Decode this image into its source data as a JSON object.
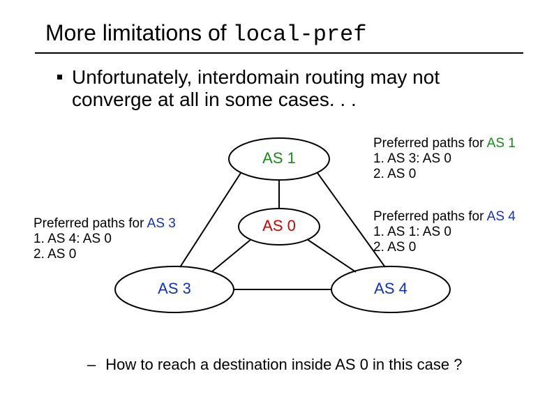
{
  "title": {
    "plain": "More limitations of ",
    "code": "local-pref"
  },
  "bullet": "Unfortunately, interdomain routing may not converge at all in some cases. . .",
  "nodes": {
    "as1": "AS 1",
    "as0": "AS 0",
    "as3": "AS 3",
    "as4": "AS 4"
  },
  "pp_as1": {
    "heading_pre": "Preferred paths for ",
    "heading_as": "AS 1",
    "l1": "1. AS 3: AS 0",
    "l2": "2. AS 0"
  },
  "pp_as4": {
    "heading_pre": "Preferred paths for ",
    "heading_as": "AS 4",
    "l1": "1. AS 1: AS 0",
    "l2": "2. AS 0"
  },
  "pp_as3": {
    "heading_pre": "Preferred paths for ",
    "heading_as": "AS 3",
    "l1": "1. AS 4: AS 0",
    "l2": "2. AS 0"
  },
  "sub_bullet": "How to reach a destination inside AS 0 in this case ?",
  "chart_data": {
    "type": "diagram",
    "title": "BGP local-pref oscillation (non-converging interdomain routing)",
    "nodes": [
      {
        "id": "AS0",
        "label": "AS 0"
      },
      {
        "id": "AS1",
        "label": "AS 1"
      },
      {
        "id": "AS3",
        "label": "AS 3"
      },
      {
        "id": "AS4",
        "label": "AS 4"
      }
    ],
    "edges": [
      [
        "AS1",
        "AS0"
      ],
      [
        "AS1",
        "AS3"
      ],
      [
        "AS1",
        "AS4"
      ],
      [
        "AS3",
        "AS0"
      ],
      [
        "AS4",
        "AS0"
      ],
      [
        "AS3",
        "AS4"
      ]
    ],
    "preferences": {
      "AS1": [
        "AS3 AS0",
        "AS0"
      ],
      "AS3": [
        "AS4 AS0",
        "AS0"
      ],
      "AS4": [
        "AS1 AS0",
        "AS0"
      ]
    }
  }
}
